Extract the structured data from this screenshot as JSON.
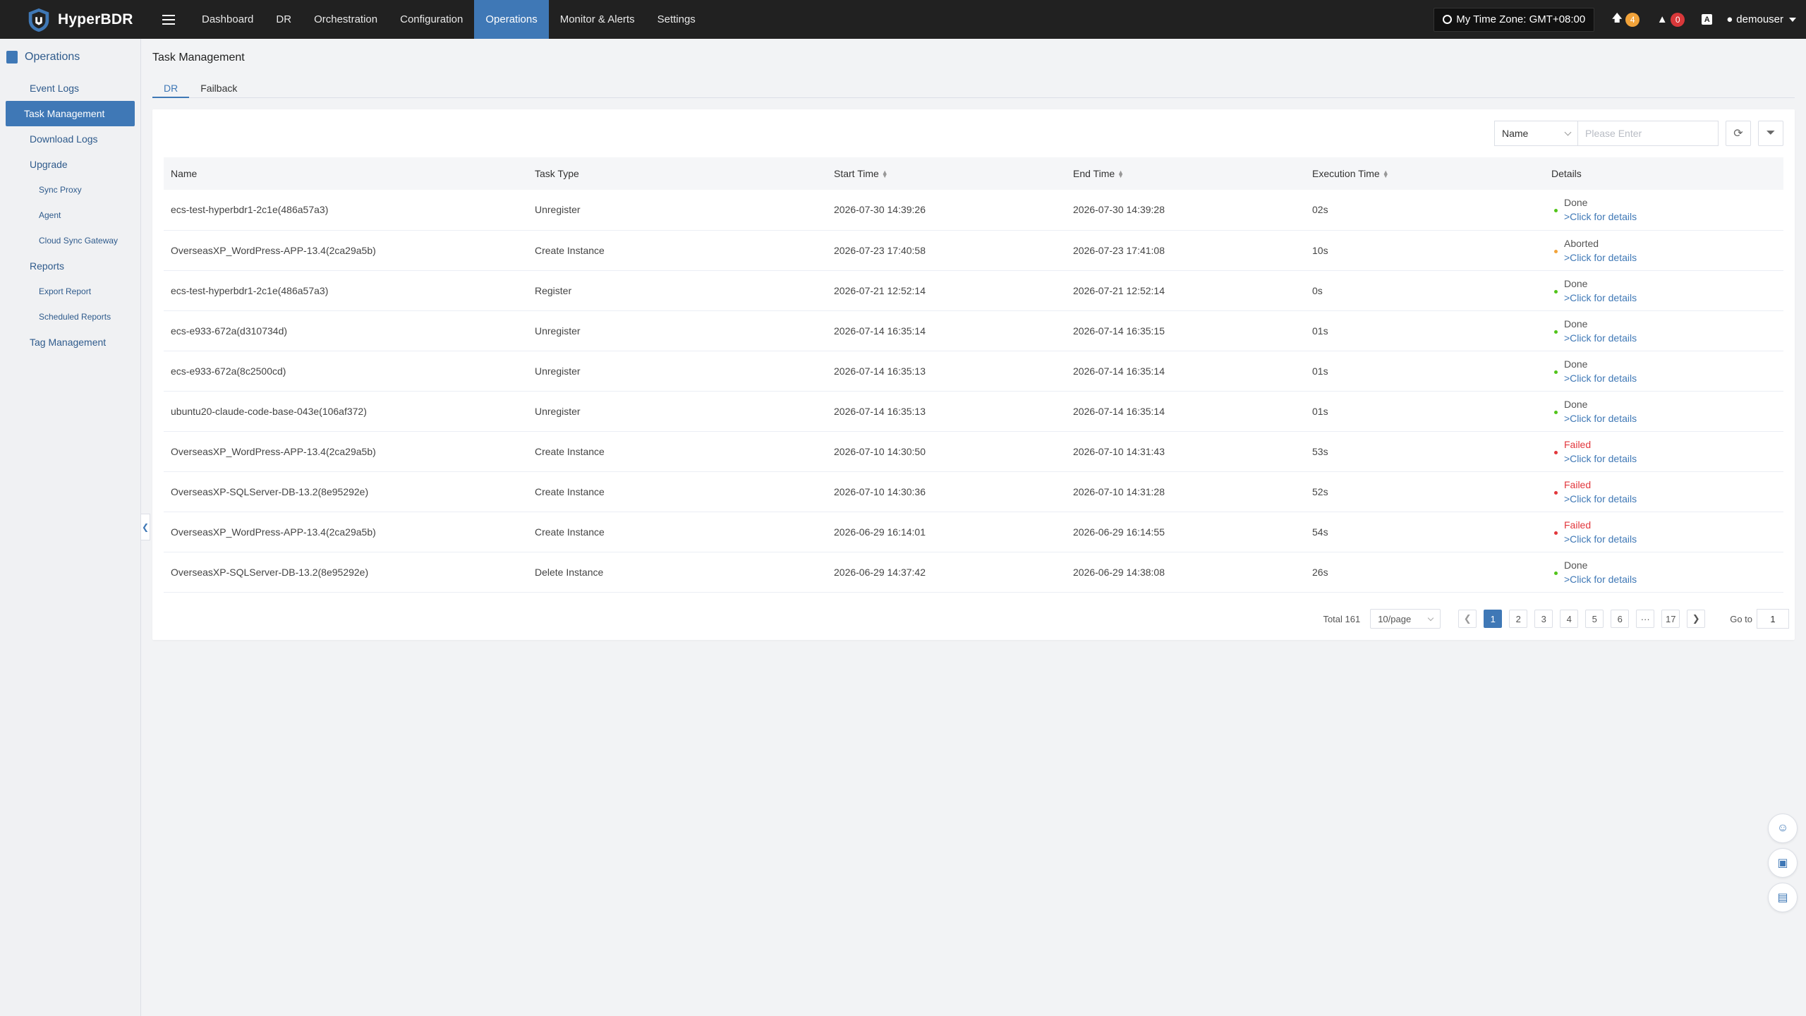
{
  "app": {
    "name": "HyperBDR"
  },
  "nav": {
    "items": [
      {
        "label": "Dashboard",
        "active": false
      },
      {
        "label": "DR",
        "active": false
      },
      {
        "label": "Orchestration",
        "active": false
      },
      {
        "label": "Configuration",
        "active": false
      },
      {
        "label": "Operations",
        "active": true
      },
      {
        "label": "Monitor & Alerts",
        "active": false
      },
      {
        "label": "Settings",
        "active": false
      }
    ]
  },
  "header": {
    "timezone": "My Time Zone: GMT+08:00",
    "upgrade_count": "4",
    "alert_count": "0",
    "user": "demouser"
  },
  "sidebar": {
    "title": "Operations",
    "items": [
      {
        "label": "Event Logs",
        "level": 1
      },
      {
        "label": "Task Management",
        "level": 1,
        "active": true
      },
      {
        "label": "Download Logs",
        "level": 1
      },
      {
        "label": "Upgrade",
        "level": 1
      },
      {
        "label": "Sync Proxy",
        "level": 2
      },
      {
        "label": "Agent",
        "level": 2
      },
      {
        "label": "Cloud Sync Gateway",
        "level": 2
      },
      {
        "label": "Reports",
        "level": 1
      },
      {
        "label": "Export Report",
        "level": 2
      },
      {
        "label": "Scheduled Reports",
        "level": 2
      },
      {
        "label": "Tag Management",
        "level": 1
      }
    ]
  },
  "page": {
    "title": "Task Management",
    "tabs": [
      {
        "label": "DR",
        "active": true
      },
      {
        "label": "Failback",
        "active": false
      }
    ]
  },
  "filter": {
    "field": "Name",
    "placeholder": "Please Enter"
  },
  "table": {
    "columns": [
      "Name",
      "Task Type",
      "Start Time",
      "End Time",
      "Execution Time",
      "Details"
    ],
    "link_text": ">Click for details",
    "rows": [
      {
        "name": "ecs-test-hyperbdr1-2c1e(486a57a3)",
        "type": "Unregister",
        "start": "2026-07-30 14:39:26",
        "end": "2026-07-30 14:39:28",
        "exec": "02s",
        "status": "Done",
        "status_color": "#52c41a"
      },
      {
        "name": "OverseasXP_WordPress-APP-13.4(2ca29a5b)",
        "type": "Create Instance",
        "start": "2026-07-23 17:40:58",
        "end": "2026-07-23 17:41:08",
        "exec": "10s",
        "status": "Aborted",
        "status_color": "#f2a33a"
      },
      {
        "name": "ecs-test-hyperbdr1-2c1e(486a57a3)",
        "type": "Register",
        "start": "2026-07-21 12:52:14",
        "end": "2026-07-21 12:52:14",
        "exec": "0s",
        "status": "Done",
        "status_color": "#52c41a"
      },
      {
        "name": "ecs-e933-672a(d310734d)",
        "type": "Unregister",
        "start": "2026-07-14 16:35:14",
        "end": "2026-07-14 16:35:15",
        "exec": "01s",
        "status": "Done",
        "status_color": "#52c41a"
      },
      {
        "name": "ecs-e933-672a(8c2500cd)",
        "type": "Unregister",
        "start": "2026-07-14 16:35:13",
        "end": "2026-07-14 16:35:14",
        "exec": "01s",
        "status": "Done",
        "status_color": "#52c41a"
      },
      {
        "name": "ubuntu20-claude-code-base-043e(106af372)",
        "type": "Unregister",
        "start": "2026-07-14 16:35:13",
        "end": "2026-07-14 16:35:14",
        "exec": "01s",
        "status": "Done",
        "status_color": "#52c41a"
      },
      {
        "name": "OverseasXP_WordPress-APP-13.4(2ca29a5b)",
        "type": "Create Instance",
        "start": "2026-07-10 14:30:50",
        "end": "2026-07-10 14:31:43",
        "exec": "53s",
        "status": "Failed",
        "status_color": "#e2373c"
      },
      {
        "name": "OverseasXP-SQLServer-DB-13.2(8e95292e)",
        "type": "Create Instance",
        "start": "2026-07-10 14:30:36",
        "end": "2026-07-10 14:31:28",
        "exec": "52s",
        "status": "Failed",
        "status_color": "#e2373c"
      },
      {
        "name": "OverseasXP_WordPress-APP-13.4(2ca29a5b)",
        "type": "Create Instance",
        "start": "2026-06-29 16:14:01",
        "end": "2026-06-29 16:14:55",
        "exec": "54s",
        "status": "Failed",
        "status_color": "#e2373c"
      },
      {
        "name": "OverseasXP-SQLServer-DB-13.2(8e95292e)",
        "type": "Delete Instance",
        "start": "2026-06-29 14:37:42",
        "end": "2026-06-29 14:38:08",
        "exec": "26s",
        "status": "Done",
        "status_color": "#52c41a"
      }
    ]
  },
  "pagination": {
    "total": "Total 161",
    "page_size": "10/page",
    "pages": [
      "1",
      "2",
      "3",
      "4",
      "5",
      "6",
      "···",
      "17"
    ],
    "current": "1",
    "goto_label": "Go to",
    "goto_value": "1"
  },
  "colors": {
    "accent": "#3f78b6",
    "topbar": "#212121"
  }
}
